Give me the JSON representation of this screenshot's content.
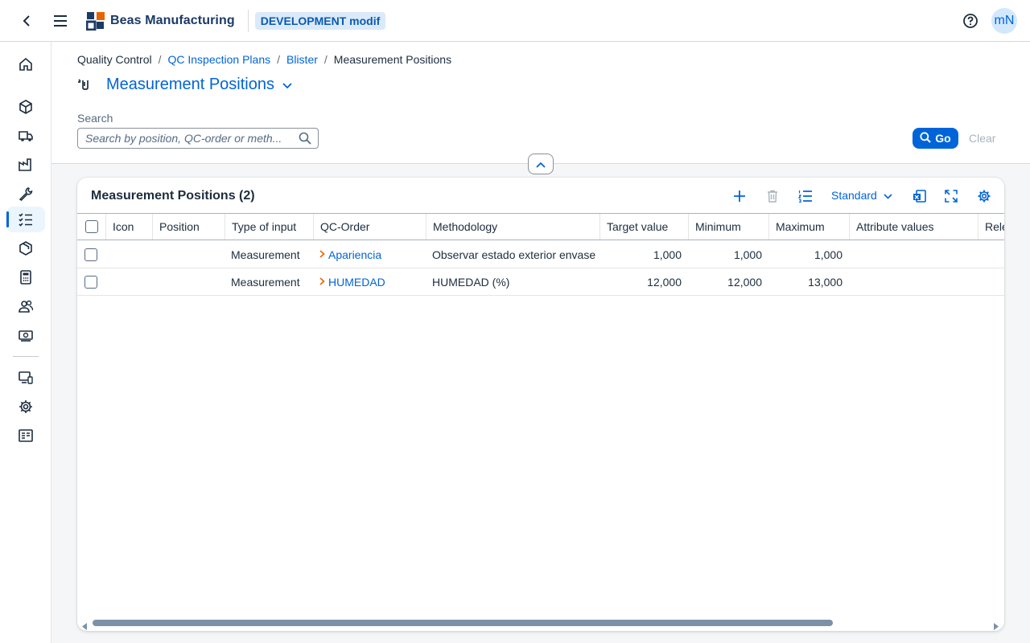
{
  "shell": {
    "brand": "Beas Manufacturing",
    "environment": "DEVELOPMENT modif",
    "avatar_initials": "mN"
  },
  "breadcrumb": [
    "Quality Control",
    "QC Inspection Plans",
    "Blister",
    "Measurement Positions"
  ],
  "page": {
    "title": "Measurement Positions"
  },
  "filter": {
    "search_label": "Search",
    "search_placeholder": "Search by position, QC-order or meth...",
    "go_label": "Go",
    "clear_label": "Clear"
  },
  "table": {
    "title": "Measurement Positions (2)",
    "variant": "Standard",
    "columns": [
      "Icon",
      "Position",
      "Type of input",
      "QC-Order",
      "Methodology",
      "Target value",
      "Minimum",
      "Maximum",
      "Attribute values",
      "Rele"
    ],
    "rows": [
      {
        "type": "Measurement",
        "qc_order": "Apariencia",
        "methodology": "Observar estado exterior envase",
        "target": "1,000",
        "minimum": "1,000",
        "maximum": "1,000"
      },
      {
        "type": "Measurement",
        "qc_order": "HUMEDAD",
        "methodology": "HUMEDAD (%)",
        "target": "12,000",
        "minimum": "12,000",
        "maximum": "13,000"
      }
    ]
  },
  "colors": {
    "accent": "#0064d9",
    "nav_arrow": "#e76500",
    "env_badge_bg": "#dbeaf9"
  },
  "icons": {
    "nav": [
      "home-icon",
      "cubes-icon",
      "truck-icon",
      "factory-icon",
      "wrench-icon",
      "checklist-icon",
      "package-icon",
      "calculator-icon",
      "people-icon",
      "money-icon",
      "devices-icon",
      "settings-icon",
      "report-icon"
    ]
  }
}
